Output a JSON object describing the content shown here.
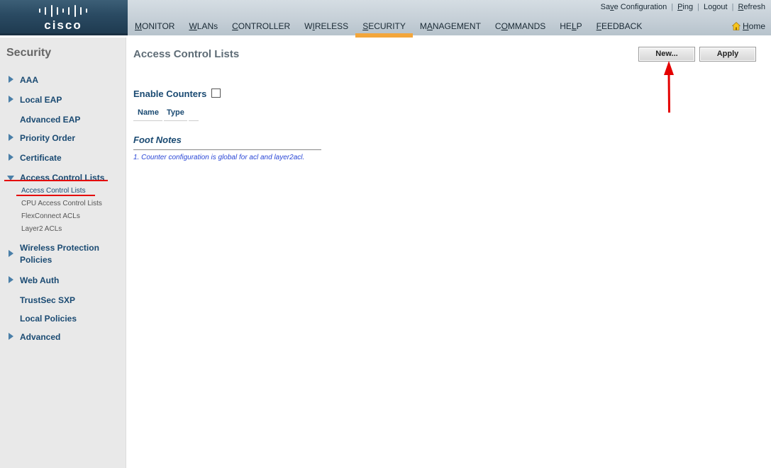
{
  "header": {
    "logo_text": "cisco",
    "top_links": [
      {
        "pre": "Sa",
        "key": "v",
        "post": "e Configuration"
      },
      {
        "pre": "",
        "key": "P",
        "post": "ing"
      },
      {
        "pre": "Logout",
        "key": "",
        "post": ""
      },
      {
        "pre": "",
        "key": "R",
        "post": "efresh"
      }
    ],
    "nav": [
      {
        "pre": "",
        "key": "M",
        "post": "ONITOR"
      },
      {
        "pre": "",
        "key": "W",
        "post": "LANs"
      },
      {
        "pre": "",
        "key": "C",
        "post": "ONTROLLER"
      },
      {
        "pre": "W",
        "key": "I",
        "post": "RELESS"
      },
      {
        "pre": "",
        "key": "S",
        "post": "ECURITY"
      },
      {
        "pre": "M",
        "key": "A",
        "post": "NAGEMENT"
      },
      {
        "pre": "C",
        "key": "O",
        "post": "MMANDS"
      },
      {
        "pre": "HE",
        "key": "L",
        "post": "P"
      },
      {
        "pre": "",
        "key": "F",
        "post": "EEDBACK"
      }
    ],
    "home": {
      "pre": "",
      "key": "H",
      "post": "ome"
    },
    "active_color": "#f3a63b"
  },
  "sidebar": {
    "title": "Security",
    "items": [
      {
        "label": "AAA"
      },
      {
        "label": "Local EAP"
      },
      {
        "label": "Advanced EAP"
      },
      {
        "label": "Priority Order"
      },
      {
        "label": "Certificate"
      },
      {
        "label": "Access Control Lists"
      },
      {
        "label": "Wireless Protection Policies"
      },
      {
        "label": "Web Auth"
      },
      {
        "label": "TrustSec SXP"
      },
      {
        "label": "Local Policies"
      },
      {
        "label": "Advanced"
      }
    ],
    "sub_items": [
      {
        "label": "Access Control Lists"
      },
      {
        "label": "CPU Access Control Lists"
      },
      {
        "label": "FlexConnect ACLs"
      },
      {
        "label": "Layer2 ACLs"
      }
    ]
  },
  "main": {
    "title": "Access Control Lists",
    "new_button": "New...",
    "apply_button": "Apply",
    "enable_counters_label": "Enable Counters",
    "columns": [
      "Name",
      "Type"
    ],
    "footnotes_title": "Foot Notes",
    "footnote": "1. Counter configuration is global for acl and layer2acl."
  },
  "annotations": {
    "highlight_color": "#e40000"
  }
}
